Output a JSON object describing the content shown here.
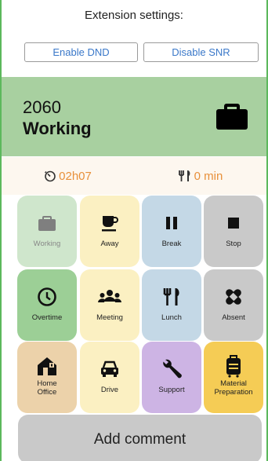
{
  "extension": {
    "title": "Extension settings:",
    "enable_dnd": "Enable DND",
    "disable_snr": "Disable SNR"
  },
  "status": {
    "number": "2060",
    "label": "Working",
    "icon": "briefcase-icon",
    "color": "#a8d0a0"
  },
  "timers": {
    "elapsed": "02h07",
    "elapsed_icon": "timer-icon",
    "lunch": "0 min",
    "lunch_icon": "fork-knife-icon",
    "color": "#e8903a"
  },
  "tiles": [
    {
      "label": "Working",
      "icon": "briefcase-icon",
      "color": "#cfe6cc"
    },
    {
      "label": "Away",
      "icon": "coffee-cup-icon",
      "color": "#fbf0c2"
    },
    {
      "label": "Break",
      "icon": "pause-icon",
      "color": "#c4d8e6"
    },
    {
      "label": "Stop",
      "icon": "stop-icon",
      "color": "#c9c9c9"
    },
    {
      "label": "Overtime",
      "icon": "clock-icon",
      "color": "#9ccf96"
    },
    {
      "label": "Meeting",
      "icon": "group-icon",
      "color": "#fbf0c2"
    },
    {
      "label": "Lunch",
      "icon": "fork-knife-icon",
      "color": "#c4d8e6"
    },
    {
      "label": "Absent",
      "icon": "bandage-icon",
      "color": "#c9c9c9"
    },
    {
      "label": "Home Office",
      "icon": "home-office-icon",
      "color": "#ecd2aa"
    },
    {
      "label": "Drive",
      "icon": "car-icon",
      "color": "#fbf0c2"
    },
    {
      "label": "Support",
      "icon": "wrench-icon",
      "color": "#cdb4e4"
    },
    {
      "label": "Material Preparation",
      "icon": "luggage-icon",
      "color": "#f5cc55"
    }
  ],
  "comment_button": "Add comment"
}
